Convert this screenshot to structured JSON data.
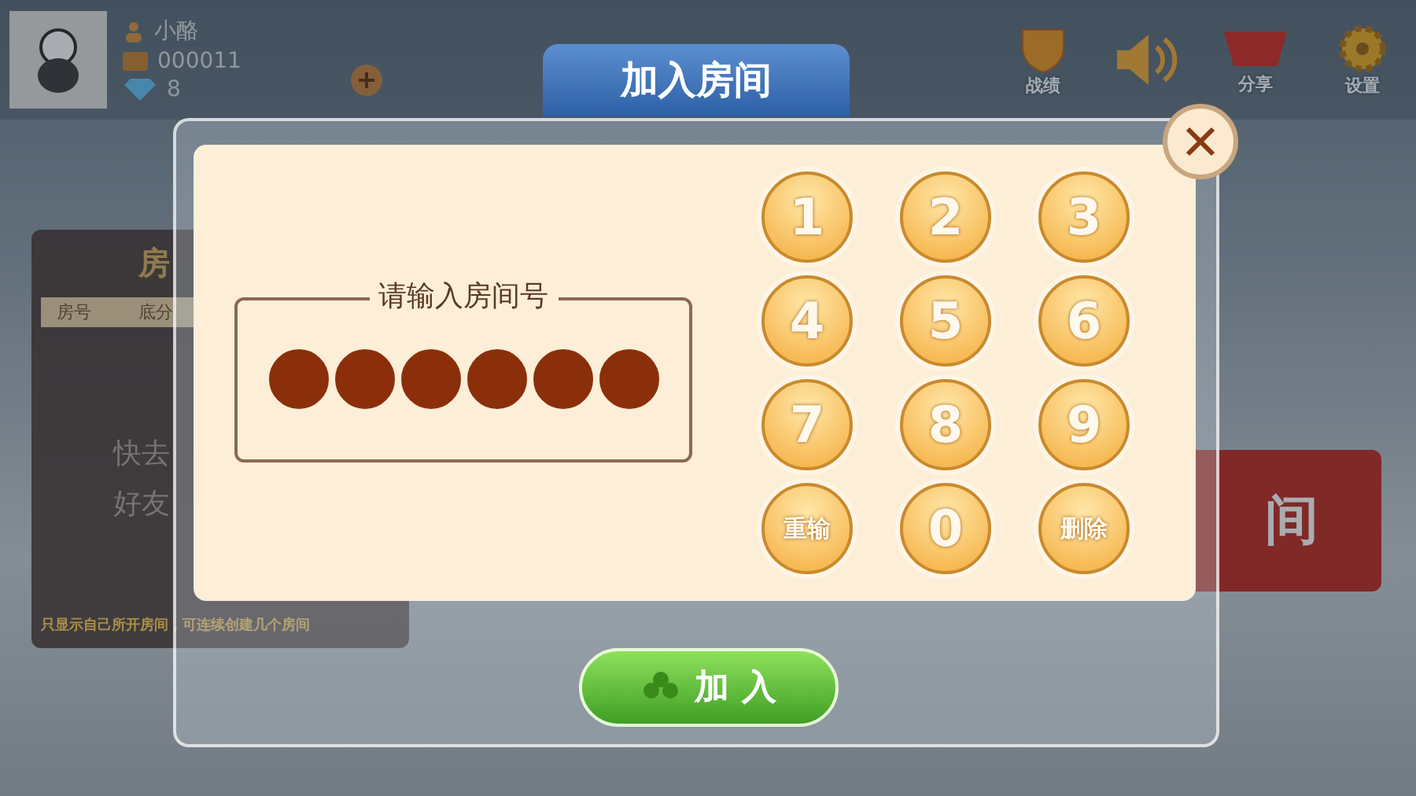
{
  "player": {
    "name": "小酪",
    "id": "000011",
    "diamonds": "8"
  },
  "top_icons": [
    {
      "kind": "record",
      "label": "战绩"
    },
    {
      "kind": "sound"
    },
    {
      "kind": "share",
      "label": "分享"
    },
    {
      "kind": "settings",
      "label": "设置"
    }
  ],
  "room_list": {
    "title": "房",
    "columns": [
      "房号",
      "底分"
    ],
    "empty_lines": [
      "快去",
      "好友"
    ],
    "footer": "只显示自己所开房间，可连续创建几个房间"
  },
  "create_room_button": {
    "label": "间"
  },
  "dialog": {
    "title": "加入房间",
    "prompt": "请输入房间号",
    "slots": [
      {
        "filled": true
      },
      {
        "filled": true
      },
      {
        "filled": true
      },
      {
        "filled": true
      },
      {
        "filled": true
      },
      {
        "filled": true
      }
    ],
    "keys": [
      {
        "kind": "digit",
        "label": "1"
      },
      {
        "kind": "digit",
        "label": "2"
      },
      {
        "kind": "digit",
        "label": "3"
      },
      {
        "kind": "digit",
        "label": "4"
      },
      {
        "kind": "digit",
        "label": "5"
      },
      {
        "kind": "digit",
        "label": "6"
      },
      {
        "kind": "digit",
        "label": "7"
      },
      {
        "kind": "digit",
        "label": "8"
      },
      {
        "kind": "digit",
        "label": "9"
      },
      {
        "kind": "action",
        "label": "重输"
      },
      {
        "kind": "digit",
        "label": "0"
      },
      {
        "kind": "action",
        "label": "删除"
      }
    ],
    "join_button": {
      "label": "加 入"
    }
  }
}
